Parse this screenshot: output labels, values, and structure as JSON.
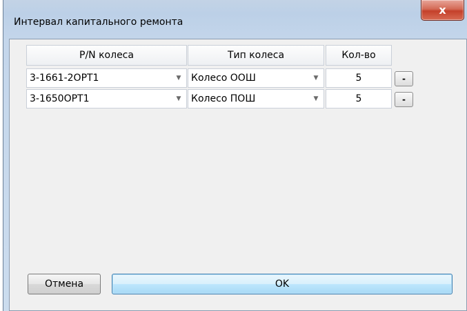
{
  "window": {
    "title": "Интервал капитального ремонта",
    "close_label": "x"
  },
  "table": {
    "columns": [
      "P/N колеса",
      "Тип колеса",
      "Кол-во"
    ],
    "rows": [
      {
        "pn": "3-1661-2OPT1",
        "type": "Колесо ООШ",
        "qty": "5",
        "remove_label": "-"
      },
      {
        "pn": "3-1650OPT1",
        "type": "Колесо ПОШ",
        "qty": "5",
        "remove_label": "-"
      }
    ]
  },
  "buttons": {
    "cancel": "Отмена",
    "ok": "OK"
  },
  "icons": {
    "dropdown": "chevron-down-icon"
  },
  "colors": {
    "ok_button_border": "#3c7fb1",
    "close_button": "#c4402a"
  }
}
